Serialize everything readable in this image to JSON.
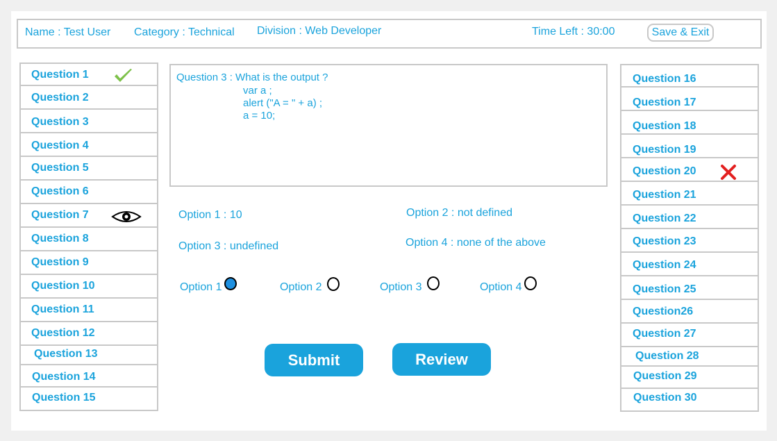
{
  "header": {
    "name": "Name : Test User",
    "category": "Category : Technical",
    "division": "Division : Web Developer",
    "time_left": "Time Left : 30:00",
    "save_exit": "Save & Exit"
  },
  "questions_left": [
    "Question 1",
    "Question 2",
    "Question 3",
    "Question 4",
    "Question 5",
    "Question 6",
    "Question 7",
    "Question 8",
    "Question 9",
    "Question 10",
    "Question 11",
    "Question 12",
    "Question 13",
    "Question 14",
    "Question 15"
  ],
  "questions_right": [
    "Question 16",
    "Question 17",
    "Question 18",
    "Question 19",
    "Question 20",
    "Question 21",
    "Question  22",
    "Question  23",
    "Question 24",
    "Question 25",
    "Question26",
    "Question  27",
    "Question 28",
    "Question 29",
    "Question 30"
  ],
  "status_icons": {
    "answered": "check-icon",
    "review": "eye-icon",
    "wrong": "cross-icon"
  },
  "question": {
    "title": "Question 3 : What is the output ?",
    "code": [
      "var a ;",
      "alert (\"A = \" + a) ;",
      "a = 10;"
    ]
  },
  "options": {
    "opt1": "Option  1 : 10",
    "opt2": "Option 2 : not defined",
    "opt3": "Option 3 : undefined",
    "opt4": "Option 4 : none of the above"
  },
  "radios": {
    "r1": "Option 1",
    "r2": "Option 2",
    "r3": "Option 3",
    "r4": "Option 4",
    "selected": "Option 1"
  },
  "buttons": {
    "submit": "Submit",
    "review": "Review"
  },
  "colors": {
    "accent": "#1aa3dc",
    "border": "#c8c8c8",
    "check": "#7dc14a",
    "cross": "#e32020"
  }
}
